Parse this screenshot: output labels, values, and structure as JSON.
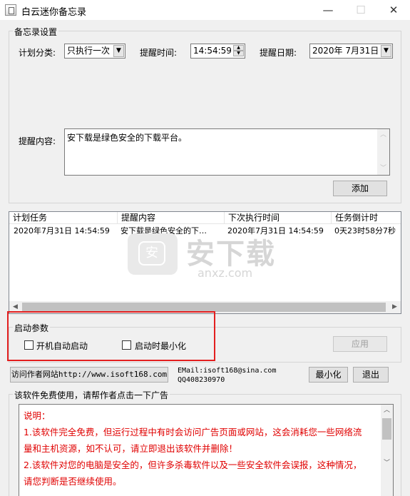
{
  "window": {
    "title": "白云迷你备忘录",
    "minimize_glyph": "—",
    "maximize_glyph": "☐",
    "close_glyph": "✕"
  },
  "settings": {
    "group_label": "备忘录设置",
    "plan_type_label": "计划分类:",
    "plan_type_value": "只执行一次",
    "remind_time_label": "提醒时间:",
    "remind_time_value": "14:54:59",
    "remind_date_label": "提醒日期:",
    "remind_date_value": "2020年 7月31日",
    "content_label": "提醒内容:",
    "content_value": "安下载是绿色安全的下载平台。",
    "add_button": "添加"
  },
  "task_list": {
    "columns": [
      "计划任务",
      "提醒内容",
      "下次执行时间",
      "任务倒计时"
    ],
    "rows": [
      [
        "2020年7月31日  14:54:59",
        "安下载是绿色安全的下…",
        "2020年7月31日  14:54:59",
        "0天23时58分7秒"
      ]
    ]
  },
  "startup": {
    "group_label": "启动参数",
    "auto_start_label": "开机自动启动",
    "auto_start_checked": false,
    "start_min_label": "启动时最小化",
    "start_min_checked": false,
    "apply_button": "应用"
  },
  "footer": {
    "visit_button": "访问作者网站http://www.isoft168.com",
    "email_line": "EMail:isoft168@sina.com",
    "qq_line": "QQ408230970",
    "minimize_button": "最小化",
    "exit_button": "退出"
  },
  "ad": {
    "group_label": "该软件免费使用，请帮作者点击一下广告",
    "lines": [
      "说明：",
      "1.该软件完全免费，但运行过程中有时会访问广告页面或网站，这会消耗您一些网络流",
      "量和主机资源，如不认可，请立即退出该软件并删除！",
      "2.该软件对您的电脑是安全的，但许多杀毒软件以及一些安全软件会误报，这种情况，",
      "请您判断是否继续使用。"
    ]
  },
  "watermark": {
    "logo_glyph": "安",
    "brand": "安下载",
    "domain": "anxz.com"
  },
  "colors": {
    "highlight_box": "#e31f1f",
    "ad_text": "#e00000"
  }
}
